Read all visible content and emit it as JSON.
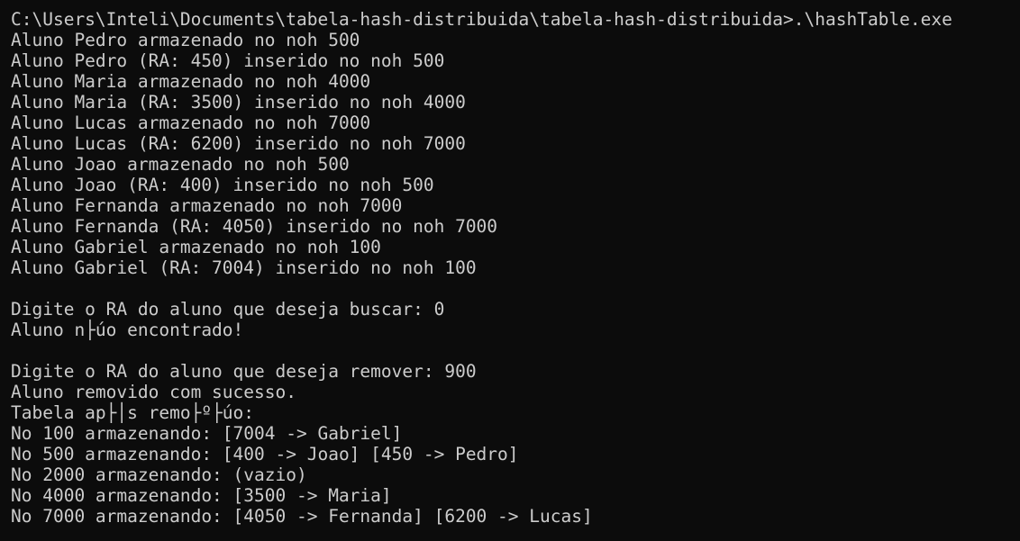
{
  "terminal": {
    "background": "#0c0c0c",
    "foreground": "#cccccc",
    "lines": [
      "C:\\Users\\Inteli\\Documents\\tabela-hash-distribuida\\tabela-hash-distribuida>.\\hashTable.exe",
      "Aluno Pedro armazenado no noh 500",
      "Aluno Pedro (RA: 450) inserido no noh 500",
      "Aluno Maria armazenado no noh 4000",
      "Aluno Maria (RA: 3500) inserido no noh 4000",
      "Aluno Lucas armazenado no noh 7000",
      "Aluno Lucas (RA: 6200) inserido no noh 7000",
      "Aluno Joao armazenado no noh 500",
      "Aluno Joao (RA: 400) inserido no noh 500",
      "Aluno Fernanda armazenado no noh 7000",
      "Aluno Fernanda (RA: 4050) inserido no noh 7000",
      "Aluno Gabriel armazenado no noh 100",
      "Aluno Gabriel (RA: 7004) inserido no noh 100",
      "",
      "Digite o RA do aluno que deseja buscar: 0",
      "Aluno n├úo encontrado!",
      "",
      "Digite o RA do aluno que deseja remover: 900",
      "Aluno removido com sucesso.",
      "Tabela ap├│s remo├º├úo:",
      "No 100 armazenando: [7004 -> Gabriel]",
      "No 500 armazenando: [400 -> Joao] [450 -> Pedro]",
      "No 2000 armazenando: (vazio)",
      "No 4000 armazenando: [3500 -> Maria]",
      "No 7000 armazenando: [4050 -> Fernanda] [6200 -> Lucas]"
    ]
  }
}
